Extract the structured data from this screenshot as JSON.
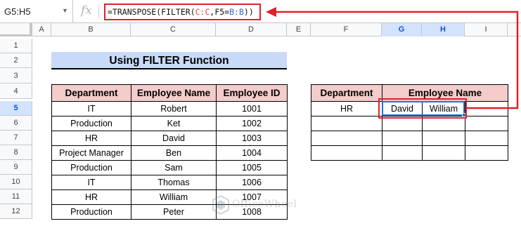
{
  "formula_bar": {
    "cell_ref": "G5:H5",
    "fx_symbol": "fx",
    "formula_parts": [
      "=TRANSPOSE(FILTER(",
      "C:C",
      ",F5=",
      "B:B",
      "))"
    ]
  },
  "columns": [
    "A",
    "B",
    "C",
    "D",
    "E",
    "F",
    "G",
    "H",
    "I"
  ],
  "rows": [
    "1",
    "2",
    "3",
    "4",
    "5",
    "6",
    "7",
    "8",
    "9",
    "10",
    "11",
    "12"
  ],
  "title": "Using FILTER Function",
  "source_table": {
    "headers": [
      "Department",
      "Employee Name",
      "Employee ID"
    ],
    "rows": [
      [
        "IT",
        "Robert",
        "1001"
      ],
      [
        "Production",
        "Ket",
        "1002"
      ],
      [
        "HR",
        "David",
        "1003"
      ],
      [
        "Project Manager",
        "Ben",
        "1004"
      ],
      [
        "Production",
        "Sam",
        "1005"
      ],
      [
        "IT",
        "Thomas",
        "1006"
      ],
      [
        "HR",
        "William",
        "1007"
      ],
      [
        "Production",
        "Peter",
        "1008"
      ]
    ]
  },
  "result_table": {
    "headers": [
      "Department",
      "Employee Name"
    ],
    "rows": [
      [
        "HR",
        "David",
        "William",
        ""
      ],
      [
        "",
        "",
        "",
        ""
      ],
      [
        "",
        "",
        "",
        ""
      ],
      [
        "",
        "",
        "",
        ""
      ]
    ]
  },
  "watermark": "OfficeWheel",
  "colors": {
    "title_fill": "#c9daf8",
    "header_fill": "#f4cccc",
    "highlight_red": "#e0202a",
    "selection_blue": "#1a73e8"
  }
}
